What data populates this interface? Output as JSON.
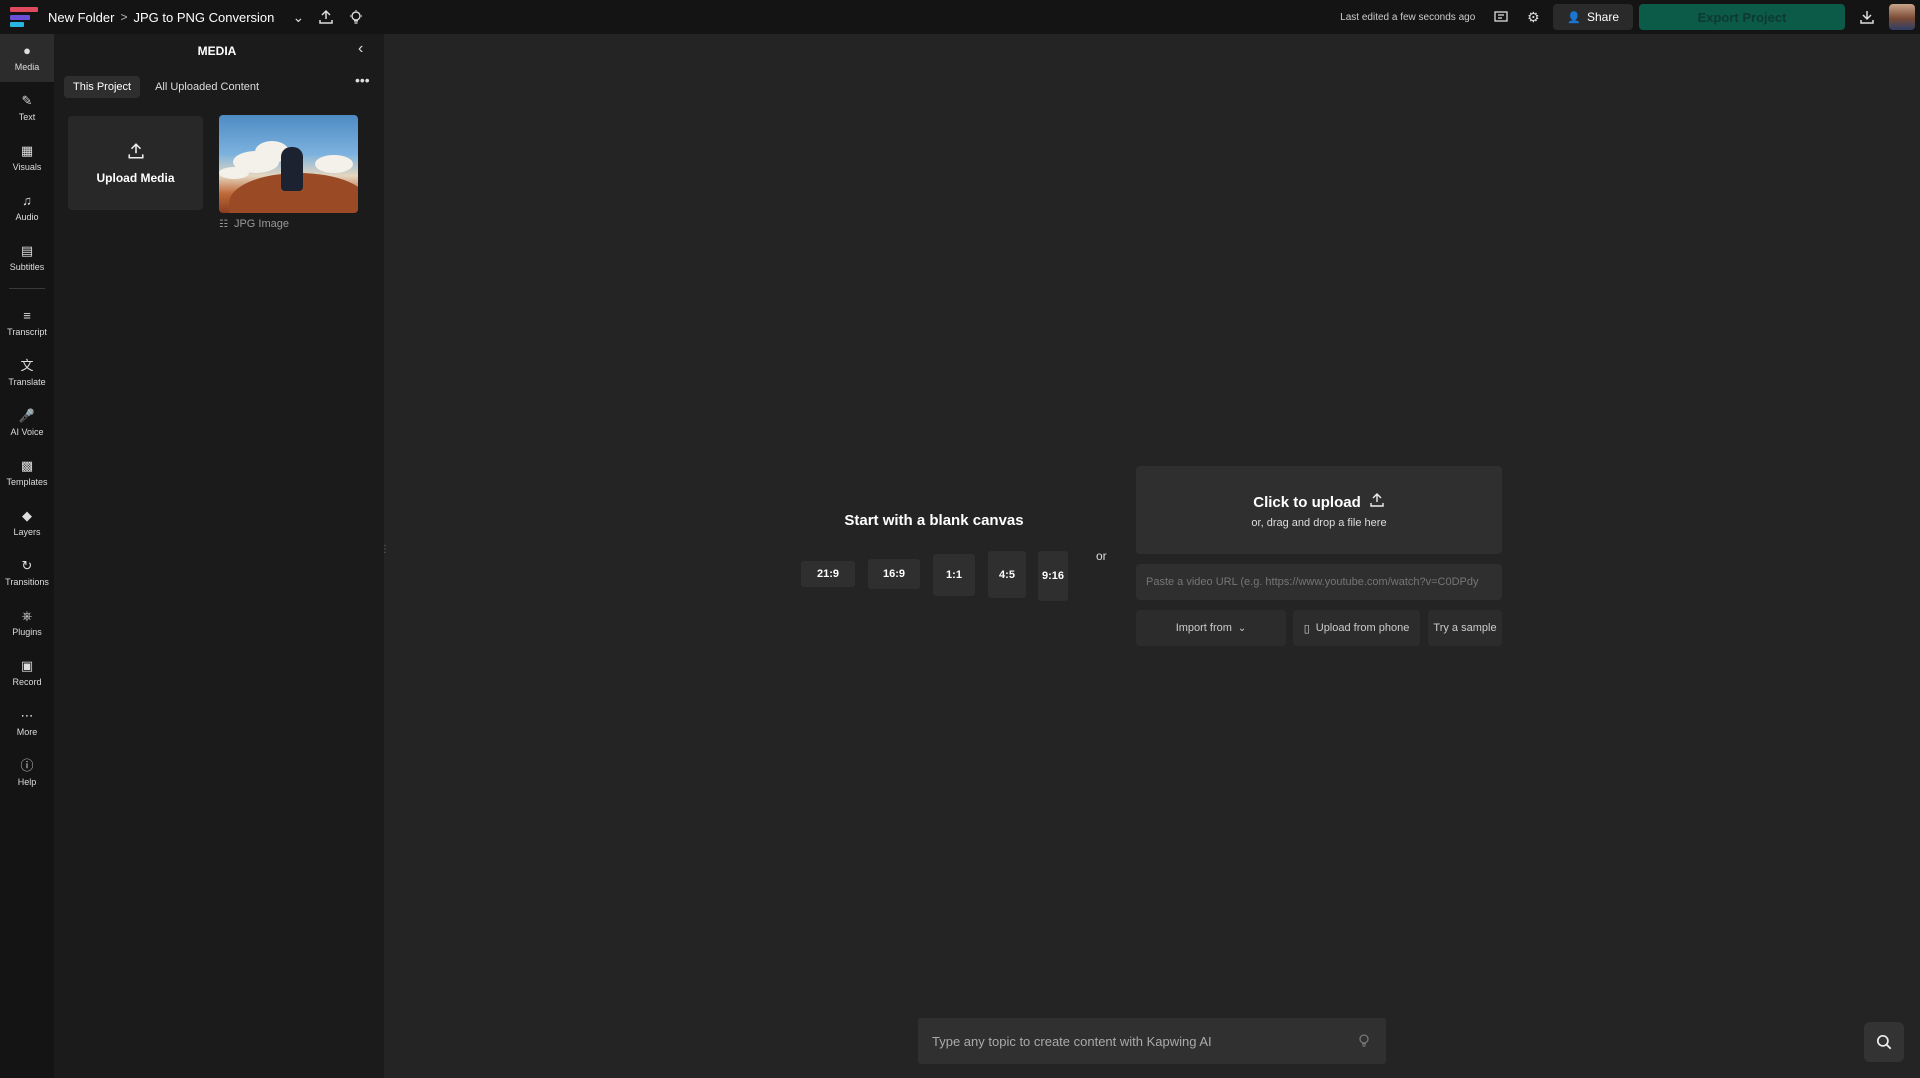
{
  "topbar": {
    "folder": "New Folder",
    "separator": ">",
    "project_name": "JPG to PNG Conversion",
    "last_edited": "Last edited a few seconds ago",
    "share_label": "Share",
    "export_label": "Export Project",
    "accent_color": "#0c5a48"
  },
  "rail": {
    "items": [
      {
        "label": "Media",
        "icon": "media-icon"
      },
      {
        "label": "Text",
        "icon": "text-icon"
      },
      {
        "label": "Visuals",
        "icon": "visuals-icon"
      },
      {
        "label": "Audio",
        "icon": "audio-icon"
      },
      {
        "label": "Subtitles",
        "icon": "subtitles-icon"
      },
      {
        "label": "Transcript",
        "icon": "transcript-icon"
      },
      {
        "label": "Translate",
        "icon": "translate-icon"
      },
      {
        "label": "AI Voice",
        "icon": "ai-voice-icon"
      },
      {
        "label": "Templates",
        "icon": "templates-icon"
      },
      {
        "label": "Layers",
        "icon": "layers-icon"
      },
      {
        "label": "Transitions",
        "icon": "transitions-icon"
      },
      {
        "label": "Plugins",
        "icon": "plugins-icon"
      },
      {
        "label": "Record",
        "icon": "record-icon"
      },
      {
        "label": "More",
        "icon": "more-icon"
      },
      {
        "label": "Help",
        "icon": "help-icon"
      }
    ]
  },
  "panel": {
    "title": "MEDIA",
    "tabs": [
      "This Project",
      "All Uploaded Content"
    ],
    "upload_label": "Upload Media",
    "media_item_label": "JPG Image"
  },
  "canvas": {
    "blank_title": "Start with a blank canvas",
    "ratios": [
      "21:9",
      "16:9",
      "1:1",
      "4:5",
      "9:16"
    ],
    "or_label": "or",
    "upload_title": "Click to upload",
    "upload_sub": "or, drag and drop a file here",
    "url_placeholder": "Paste a video URL (e.g. https://www.youtube.com/watch?v=C0DPdy",
    "import_label": "Import from",
    "phone_label": "Upload from phone",
    "sample_label": "Try a sample",
    "ai_placeholder": "Type any topic to create content with Kapwing AI"
  }
}
